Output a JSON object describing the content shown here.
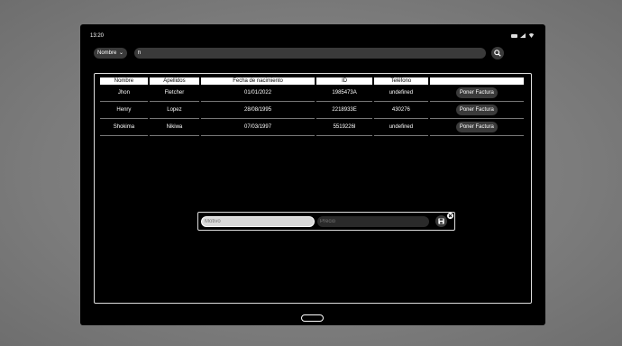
{
  "status": {
    "time": "13:20"
  },
  "filter": {
    "selected": "Nombre"
  },
  "search": {
    "value": "h"
  },
  "table": {
    "headers": [
      "Nombre",
      "Apellidos",
      "Fecha de nacimiento",
      "ID",
      "Teléfono",
      ""
    ],
    "rows": [
      {
        "nombre": "Jhon",
        "apellidos": "Fletcher",
        "fecha": "01/01/2022",
        "id": "1985473A",
        "telefono": "undefined",
        "action": "Poner Factura"
      },
      {
        "nombre": "Henry",
        "apellidos": "Lopez",
        "fecha": "28/08/1995",
        "id": "2218933E",
        "telefono": "430276",
        "action": "Poner Factura"
      },
      {
        "nombre": "Shokima",
        "apellidos": "Nikiwa",
        "fecha": "07/03/1997",
        "id": "5519226I",
        "telefono": "undefined",
        "action": "Poner Factura"
      }
    ]
  },
  "invoice_form": {
    "motivo_placeholder": "Motivo",
    "precio_placeholder": "Precio"
  },
  "icons": {
    "search": "search-icon",
    "save": "save-icon",
    "close": "close-icon",
    "dropdown": "chevron-down-icon"
  }
}
